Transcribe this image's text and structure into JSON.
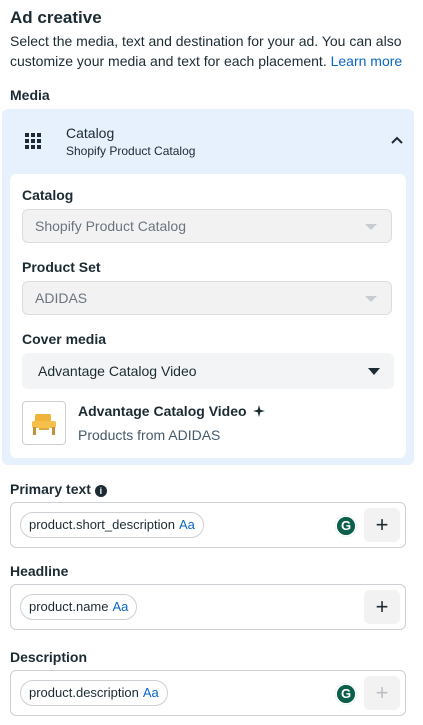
{
  "header": {
    "title": "Ad creative",
    "subtitle": "Select the media, text and destination for your ad. You can also customize your media and text for each placement.",
    "learn_more": "Learn more"
  },
  "media": {
    "section_label": "Media",
    "source_title": "Catalog",
    "source_subtitle": "Shopify Product Catalog",
    "catalog_label": "Catalog",
    "catalog_value": "Shopify Product Catalog",
    "product_set_label": "Product Set",
    "product_set_value": "ADIDAS",
    "cover_media_label": "Cover media",
    "cover_media_value": "Advantage Catalog Video",
    "preview_title": "Advantage Catalog Video",
    "preview_subtitle": "Products from ADIDAS"
  },
  "primary_text": {
    "label": "Primary text",
    "token": "product.short_description",
    "token_aa": "Aa"
  },
  "headline": {
    "label": "Headline",
    "token": "product.name",
    "token_aa": "Aa"
  },
  "description": {
    "label": "Description",
    "token": "product.description",
    "token_aa": "Aa"
  },
  "icons": {
    "grid": "grid-icon",
    "chevron": "chevron-up-icon",
    "info": "info-icon",
    "sparkle": "sparkle-icon",
    "grammarly": "grammarly-icon",
    "plus": "plus-icon"
  },
  "colors": {
    "accent_link": "#0a66c2",
    "media_panel_bg": "#e7f0fd",
    "grammarly_green": "#15c39a"
  }
}
